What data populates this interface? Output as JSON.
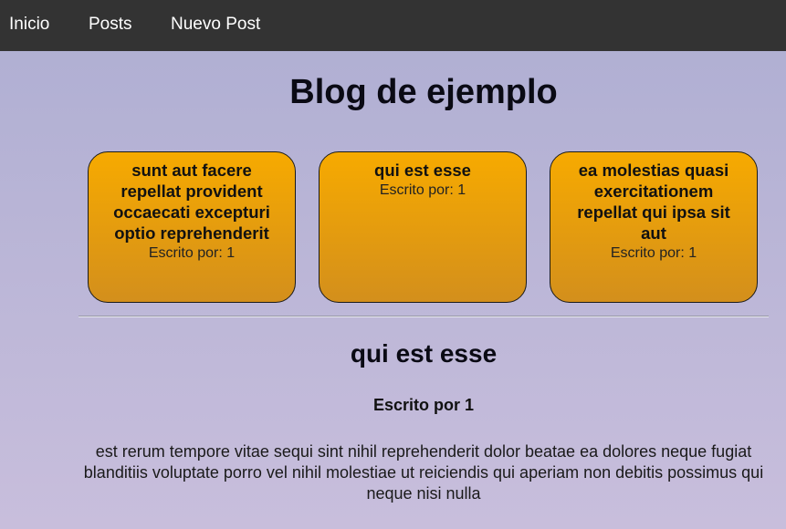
{
  "nav": {
    "items": [
      {
        "label": "Inicio"
      },
      {
        "label": "Posts"
      },
      {
        "label": "Nuevo Post"
      }
    ]
  },
  "header": {
    "title": "Blog de ejemplo"
  },
  "posts": [
    {
      "title": "sunt aut facere repellat provident occaecati excepturi optio reprehenderit",
      "author": "Escrito por: 1"
    },
    {
      "title": "qui est esse",
      "author": "Escrito por: 1"
    },
    {
      "title": "ea molestias quasi exercitationem repellat qui ipsa sit aut",
      "author": "Escrito por: 1"
    }
  ],
  "selected_post": {
    "title": "qui est esse",
    "author": "Escrito por 1",
    "body": "est rerum tempore vitae sequi sint nihil reprehenderit dolor beatae ea dolores neque fugiat blanditiis voluptate porro vel nihil molestiae ut reiciendis qui aperiam non debitis possimus qui neque nisi nulla"
  },
  "colors": {
    "navbar": "#333333",
    "card_gradient_top": "#f7aa00",
    "card_gradient_bottom": "#d38f1c",
    "background_top": "#aeaed2",
    "background_bottom": "#c8bedc"
  }
}
